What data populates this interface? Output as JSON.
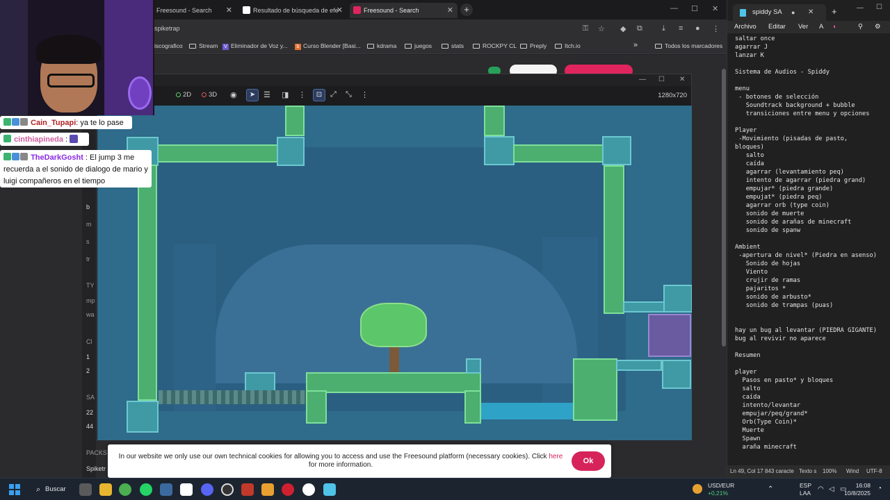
{
  "browser": {
    "tabs": [
      {
        "label": "Freesound - Search",
        "icon_color": "#e0245e",
        "active": false
      },
      {
        "label": "Resultado de búsqueda de efe",
        "icon_color": "#ffffff",
        "active": false
      },
      {
        "label": "Freesound - Search",
        "icon_color": "#e0245e",
        "active": true
      }
    ],
    "new_tab": "+",
    "url": "spiketrap",
    "bookmarks": [
      "iscografico",
      "Stream",
      "Eliminador de Voz y...",
      "Curso Blender [Basi...",
      "kdrama",
      "juegos",
      "stats",
      "ROCKPY CL",
      "Preply",
      "Itch.io"
    ],
    "bookmarks_overflow": "»",
    "all_bookmarks": "Todos los marcadores",
    "side_letters": [
      "b",
      "m",
      "s",
      "tr",
      "TY",
      "mp",
      "wa",
      "Cl",
      "1",
      "2",
      "SA",
      "22",
      "44",
      "PACKS",
      "Spiketr"
    ]
  },
  "editor": {
    "toolbar": {
      "mode_label": "rada",
      "view_2d": "2D",
      "view_3d": "3D",
      "resolution": "1280x720"
    }
  },
  "cookie": {
    "text_before": "In our website we only use our own technical cookies for allowing you to access and use the Freesound platform (necessary cookies). Click ",
    "link": "here",
    "text_after": " for more information.",
    "ok": "Ok"
  },
  "chat": [
    {
      "user": "Cain_Tupapi",
      "text": ": ya te lo pase",
      "style": "red"
    },
    {
      "user": "cinthiapineda",
      "text": " :",
      "style": "pink"
    },
    {
      "user": "TheDarkGosht",
      "text": " : El jump 3 me recuerda a el sonido de dialogo de mario y luigi compañeros en el tiempo",
      "style": "purple"
    }
  ],
  "notepad": {
    "tab_title": "spiddy SA",
    "tab_dot": "●",
    "tab_close": "✕",
    "new_tab": "+",
    "menu": [
      "Archivo",
      "Editar",
      "Ver"
    ],
    "lines": [
      "saltar once",
      "agarrar J",
      "lanzar K",
      "",
      "Sistema de Audios - Spiddy",
      "",
      "menu",
      " - botones de selección",
      "   Soundtrack background + bubble",
      "   transiciones entre menu y opciones",
      "",
      "Player",
      " -Movimiento (pisadas de pasto,",
      "bloques)",
      "   salto",
      "   caída",
      "   agarrar (levantamiento peq)",
      "   intento de agarrar (piedra grand)",
      "   empujar* (piedra grande)",
      "   empujat* (piedra peq)",
      "   agarrar orb (type coin)",
      "   sonido de muerte",
      "   sonido de arañas de minecraft",
      "   sonido de spanw",
      "",
      "Ambient",
      " -apertura de nivel* (Piedra en asenso)",
      "   Sonido de hojas",
      "   Viento",
      "   crujir de ramas",
      "   pajaritos *",
      "   sonido de arbusto*",
      "   sonido de trampas (puas)",
      "",
      "",
      "hay un bug al levantar (PIEDRA GIGANTE)",
      "bug al revivir no aparece",
      "",
      "Resumen",
      "",
      "player",
      "  Pasos en pasto* y bloques",
      "  salto",
      "  caída",
      "  intento/levantar",
      "  empujar/peq/grand*",
      "  Orb(Type Coin)*",
      "  Muerte",
      "  Spawn",
      "  araña minecraft"
    ],
    "status": {
      "position": "Ln 49, Col 17",
      "chars": "843 caracte",
      "mode": "Texto s",
      "zoom": "100%",
      "eol": "Wind",
      "encoding": "UTF-8"
    }
  },
  "taskbar": {
    "search": "Buscar",
    "currency": "USD/EUR",
    "currency_change": "+0,21%",
    "lang_1": "ESP",
    "lang_2": "LAA",
    "time": "16:08",
    "date": "10/8/2025"
  },
  "colors": {
    "accent": "#e0245e",
    "game_bg": "#2f6b8a",
    "grass": "#4caf70"
  }
}
